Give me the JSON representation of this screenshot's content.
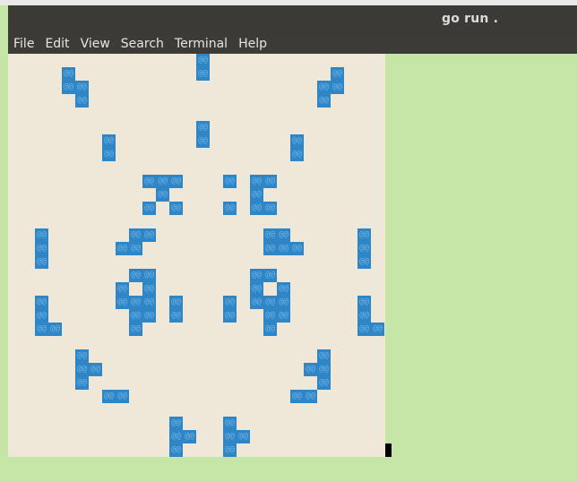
{
  "window": {
    "title": "go run .",
    "menu": [
      "File",
      "Edit",
      "View",
      "Search",
      "Terminal",
      "Help"
    ]
  },
  "terminal": {
    "cell_glyph": "@@",
    "cell_color": "#2f86c6",
    "background": "#efe8d8",
    "alive_cells": [
      [
        14,
        0
      ],
      [
        14,
        1
      ],
      [
        4,
        1
      ],
      [
        24,
        1
      ],
      [
        4,
        2
      ],
      [
        5,
        2
      ],
      [
        23,
        2
      ],
      [
        24,
        2
      ],
      [
        5,
        3
      ],
      [
        23,
        3
      ],
      [
        14,
        5
      ],
      [
        14,
        6
      ],
      [
        7,
        6
      ],
      [
        21,
        6
      ],
      [
        7,
        7
      ],
      [
        21,
        7
      ],
      [
        10,
        9
      ],
      [
        11,
        9
      ],
      [
        12,
        9
      ],
      [
        16,
        9
      ],
      [
        18,
        9
      ],
      [
        19,
        9
      ],
      [
        11,
        10
      ],
      [
        18,
        10
      ],
      [
        10,
        11
      ],
      [
        12,
        11
      ],
      [
        16,
        11
      ],
      [
        18,
        11
      ],
      [
        19,
        11
      ],
      [
        2,
        13
      ],
      [
        9,
        13
      ],
      [
        10,
        13
      ],
      [
        19,
        13
      ],
      [
        20,
        13
      ],
      [
        26,
        13
      ],
      [
        2,
        14
      ],
      [
        9,
        14
      ],
      [
        8,
        14
      ],
      [
        19,
        14
      ],
      [
        20,
        14
      ],
      [
        21,
        14
      ],
      [
        26,
        14
      ],
      [
        2,
        15
      ],
      [
        26,
        15
      ],
      [
        9,
        16
      ],
      [
        10,
        16
      ],
      [
        18,
        16
      ],
      [
        19,
        16
      ],
      [
        8,
        17
      ],
      [
        10,
        17
      ],
      [
        18,
        17
      ],
      [
        20,
        17
      ],
      [
        8,
        18
      ],
      [
        9,
        18
      ],
      [
        10,
        18
      ],
      [
        12,
        18
      ],
      [
        16,
        18
      ],
      [
        18,
        18
      ],
      [
        19,
        18
      ],
      [
        20,
        18
      ],
      [
        26,
        18
      ],
      [
        2,
        18
      ],
      [
        2,
        19
      ],
      [
        9,
        19
      ],
      [
        10,
        19
      ],
      [
        12,
        19
      ],
      [
        16,
        19
      ],
      [
        19,
        19
      ],
      [
        20,
        19
      ],
      [
        26,
        19
      ],
      [
        2,
        20
      ],
      [
        3,
        20
      ],
      [
        9,
        20
      ],
      [
        19,
        20
      ],
      [
        26,
        20
      ],
      [
        27,
        20
      ],
      [
        5,
        22
      ],
      [
        23,
        22
      ],
      [
        5,
        23
      ],
      [
        6,
        23
      ],
      [
        22,
        23
      ],
      [
        23,
        23
      ],
      [
        5,
        24
      ],
      [
        23,
        24
      ],
      [
        7,
        25
      ],
      [
        8,
        25
      ],
      [
        21,
        25
      ],
      [
        22,
        25
      ],
      [
        12,
        27
      ],
      [
        16,
        27
      ],
      [
        12,
        28
      ],
      [
        13,
        28
      ],
      [
        16,
        28
      ],
      [
        17,
        28
      ],
      [
        12,
        29
      ],
      [
        16,
        29
      ]
    ]
  }
}
